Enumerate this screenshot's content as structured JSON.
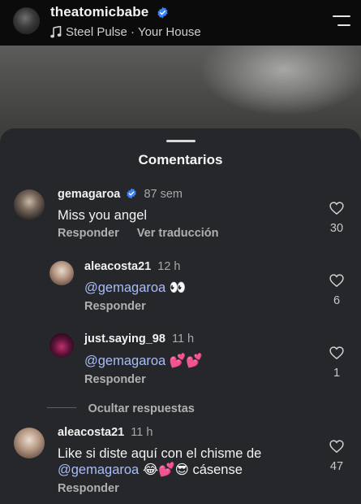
{
  "header": {
    "username": "theatomicbabe",
    "music": "Steel Pulse · Your House"
  },
  "sheet": {
    "title": "Comentarios"
  },
  "colors": {
    "sheet_bg": "#25272a",
    "mention": "#a9bdf6",
    "verified": "#3b82f6"
  },
  "comments": [
    {
      "username": "gemagaroa",
      "verified": true,
      "time": "87 sem",
      "text": "Miss you angel",
      "reply_label": "Responder",
      "translate_label": "Ver traducción",
      "likes": "30"
    },
    {
      "username": "aleacosta21",
      "time": "12 h",
      "mention": "@gemagaroa",
      "emoji": "👀",
      "reply_label": "Responder",
      "likes": "6"
    },
    {
      "username": "just.saying_98",
      "time": "11 h",
      "mention": "@gemagaroa",
      "emoji": "💕💕",
      "reply_label": "Responder",
      "likes": "1"
    },
    {
      "username": "aleacosta21",
      "time": "11 h",
      "text_line1": "Like si diste aquí con el chisme de",
      "mention": "@gemagaroa",
      "emoji": "😂💕😎",
      "text_line2_rest": "cásense",
      "reply_label": "Responder",
      "likes": "47"
    }
  ],
  "hide_replies_label": "Ocultar respuestas",
  "icons": [
    "music-note-icon",
    "verified-badge-icon",
    "menu-icon",
    "heart-icon"
  ]
}
